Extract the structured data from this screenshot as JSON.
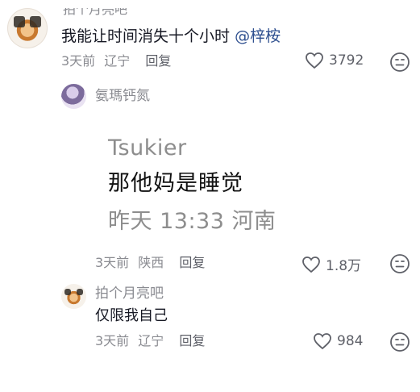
{
  "comment_top": {
    "cut_username": "拍个月亮吧",
    "text": "我能让时间消失十个小时",
    "mention": "@梓桉",
    "time": "3天前",
    "location": "辽宁",
    "reply_label": "回复",
    "likes": "3792"
  },
  "reply_1": {
    "username": "氨瑪钙氮",
    "quote": {
      "user": "Tsukier",
      "text": "那他妈是睡觉",
      "time": "昨天 13:33 河南"
    },
    "time": "3天前",
    "location": "陕西",
    "reply_label": "回复",
    "likes": "1.8万"
  },
  "reply_2": {
    "username": "拍个月亮吧",
    "text": "仅限我自己",
    "time": "3天前",
    "location": "辽宁",
    "reply_label": "回复",
    "likes": "984"
  },
  "icons": {
    "heart": "heart-icon",
    "dislike": "dislike-face-icon"
  },
  "colors": {
    "text_primary": "#161823",
    "text_secondary": "#8a8b91",
    "mention": "#2e4f8f"
  }
}
